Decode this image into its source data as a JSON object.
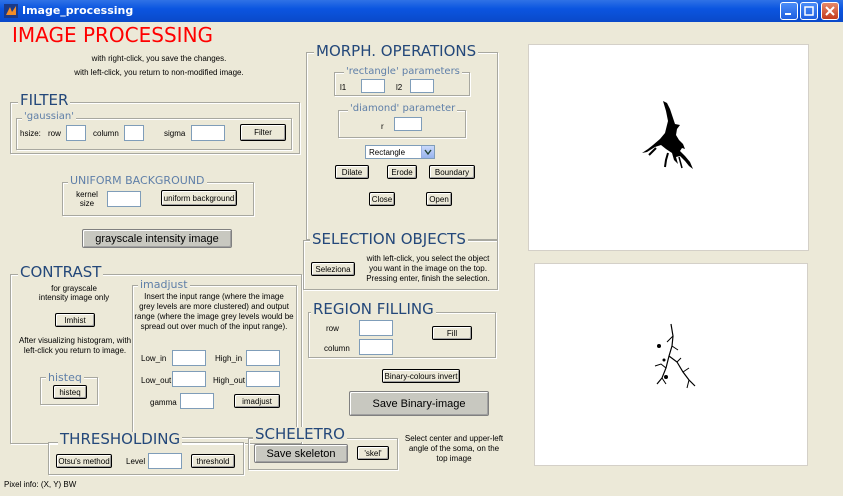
{
  "window": {
    "title": "Image_processing"
  },
  "app_title": "IMAGE PROCESSING",
  "intro": {
    "line1": "with right-click, you save the changes.",
    "line2": "with left-click, you return to non-modified image."
  },
  "filter": {
    "title": "FILTER",
    "sub_title": "'gaussian'",
    "hsize_label": "hsize:",
    "row_label": "row",
    "column_label": "column",
    "sigma_label": "sigma",
    "button": "Filter"
  },
  "uniform": {
    "title": "UNIFORM BACKGROUND",
    "kernel_line1": "kernel",
    "kernel_line2": "size",
    "button": "uniform background"
  },
  "grayscale_button": "grayscale intensity image",
  "contrast": {
    "title": "CONTRAST",
    "note1": "for grayscale",
    "note2": "intensity image only",
    "imhist_button": "Imhist",
    "after1": "After visualizing histogram, with",
    "after2": "left-click  you return to image.",
    "histeq_title": "histeq",
    "histeq_button": "histeq",
    "imadjust_title": "imadjust",
    "imadjust_desc1": "Insert the input range (where the image",
    "imadjust_desc2": "grey levels are more clustered) and output",
    "imadjust_desc3": "range (where the image grey levels would be",
    "imadjust_desc4": "spread out over much of the input range).",
    "low_in": "Low_in",
    "high_in": "High_in",
    "low_out": "Low_out",
    "high_out": "High_out",
    "gamma": "gamma",
    "imadjust_button": "imadjust"
  },
  "threshold": {
    "title": "THRESHOLDING",
    "otsu_button": "Otsu's method",
    "level_label": "Level",
    "button": "threshold"
  },
  "morph": {
    "title": "MORPH. OPERATIONS",
    "rect_title": "'rectangle' parameters",
    "l1": "l1",
    "l2": "l2",
    "diamond_title": "'diamond' parameter",
    "r": "r",
    "select_value": "Rectangle",
    "dilate": "Dilate",
    "erode": "Erode",
    "boundary": "Boundary",
    "close": "Close",
    "open": "Open"
  },
  "selection": {
    "title": "SELECTION OBJECTS",
    "button": "Seleziona",
    "desc1": "with left-click, you select the object",
    "desc2": "you want in the image on the top.",
    "desc3": "Pressing enter, finish the selection."
  },
  "region": {
    "title": "REGION FILLING",
    "row_label": "row",
    "column_label": "column",
    "button": "Fill"
  },
  "binary_invert_button": "Binary-colours invert",
  "save_binary_button": "Save Binary-image",
  "skeleton": {
    "title": "SCHELETRO",
    "save_button": "Save skeleton",
    "skel_button": "'skel'",
    "desc1": "Select center and upper-left",
    "desc2": "angle of the soma, on the",
    "desc3": "top image"
  },
  "status": {
    "pixel_info": "Pixel info: (X, Y)  BW"
  },
  "colors": {
    "title_red": "#ff0000",
    "group_title_blue": "#24487a",
    "window_bg": "#ece9d8"
  }
}
